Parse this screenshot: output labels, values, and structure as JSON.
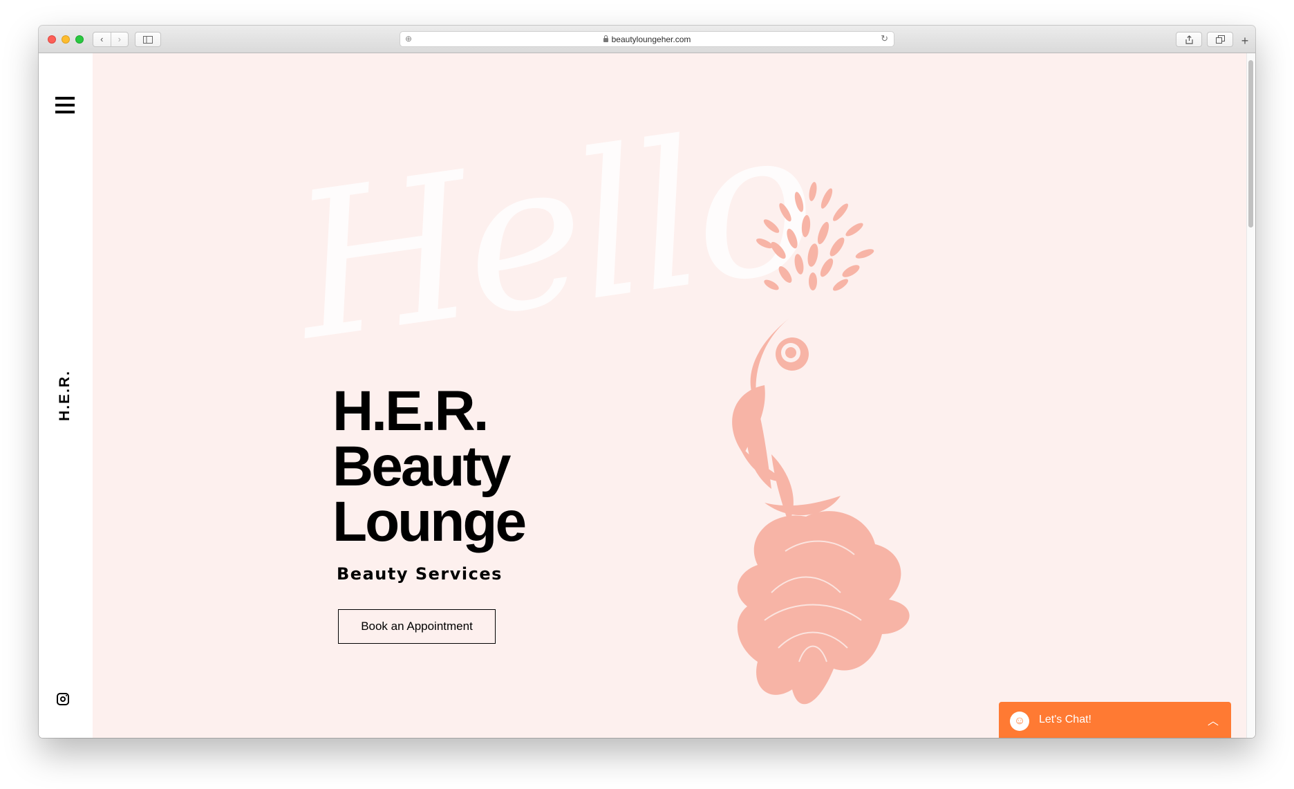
{
  "browser": {
    "url": "beautyloungeher.com",
    "back_icon": "‹",
    "forward_icon": "›"
  },
  "sidebar": {
    "logo": "H.E.R."
  },
  "hero": {
    "script_text": "Hello",
    "title_line1": "H.E.R.",
    "title_line2": "Beauty",
    "title_line3": "Lounge",
    "subtitle": "Beauty Services",
    "cta_label": "Book an Appointment"
  },
  "chat": {
    "label": "Let's Chat!"
  },
  "colors": {
    "page_background": "#fdf0ee",
    "flower": "#f7b4a6",
    "chat_accent": "#ff7a33",
    "text": "#000000"
  }
}
